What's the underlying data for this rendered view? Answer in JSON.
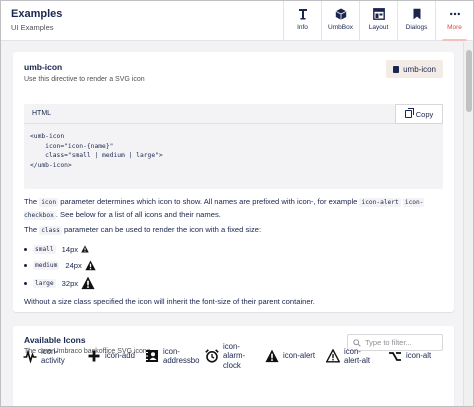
{
  "header": {
    "title": "Examples",
    "subtitle": "UI Examples"
  },
  "apps": [
    {
      "label": "Info",
      "icon": "info-icon"
    },
    {
      "label": "UmbBox",
      "icon": "box-icon"
    },
    {
      "label": "Layout",
      "icon": "layout-icon"
    },
    {
      "label": "Dialogs",
      "icon": "bookmark-icon"
    },
    {
      "label": "More",
      "icon": "more-icon"
    }
  ],
  "section1": {
    "title": "umb-icon",
    "subtitle": "Use this directive to render a SVG icon",
    "demo_button": "umb-icon",
    "code": {
      "lang": "HTML",
      "copy_label": "Copy",
      "lines": [
        "<umb-icon",
        "    icon=\"icon-{name}\"",
        "    class=\"small | medium | large\">",
        "</umb-icon>"
      ]
    },
    "para1": {
      "t1": "The ",
      "c1": "icon",
      "t2": " parameter determines which icon to show. All names are prefixed with icon-, for example ",
      "c2": "icon-alert",
      "t3": " ",
      "c3": "icon-checkbox",
      "t4": ". See below for a list of all icons and their names."
    },
    "para2": {
      "t1": "The ",
      "c1": "class",
      "t2": " parameter can be used to render the icon with a fixed size:"
    },
    "sizes": [
      {
        "name": "small",
        "px": "14px"
      },
      {
        "name": "medium",
        "px": "24px"
      },
      {
        "name": "large",
        "px": "32px"
      }
    ],
    "para3": "Without a size class specified the icon will inherit the font-size of their parent container."
  },
  "section2": {
    "title": "Available Icons",
    "subtitle": "The core Umbraco backoffice SVG icons",
    "filter_placeholder": "Type to filter...",
    "icons": [
      {
        "label": "icon-activity",
        "l1": "icon-",
        "l2": "activity",
        "glyph": "activity-icon"
      },
      {
        "label": "icon-add",
        "l1": "icon-add",
        "l2": "",
        "glyph": "add-icon"
      },
      {
        "label": "icon-addressbo",
        "l1": "icon-",
        "l2": "addressbo",
        "glyph": "addressbook-icon"
      },
      {
        "label": "icon-alarm-clock",
        "l1": "icon-",
        "l2": "alarm-",
        "l3": "clock",
        "glyph": "alarm-clock-icon"
      },
      {
        "label": "icon-alert",
        "l1": "icon-alert",
        "l2": "",
        "glyph": "alert-icon"
      },
      {
        "label": "icon-alert-alt",
        "l1": "icon-",
        "l2": "alert-alt",
        "glyph": "alert-alt-icon"
      },
      {
        "label": "icon-alt",
        "l1": "icon-alt",
        "l2": "",
        "glyph": "alt-icon"
      }
    ]
  }
}
